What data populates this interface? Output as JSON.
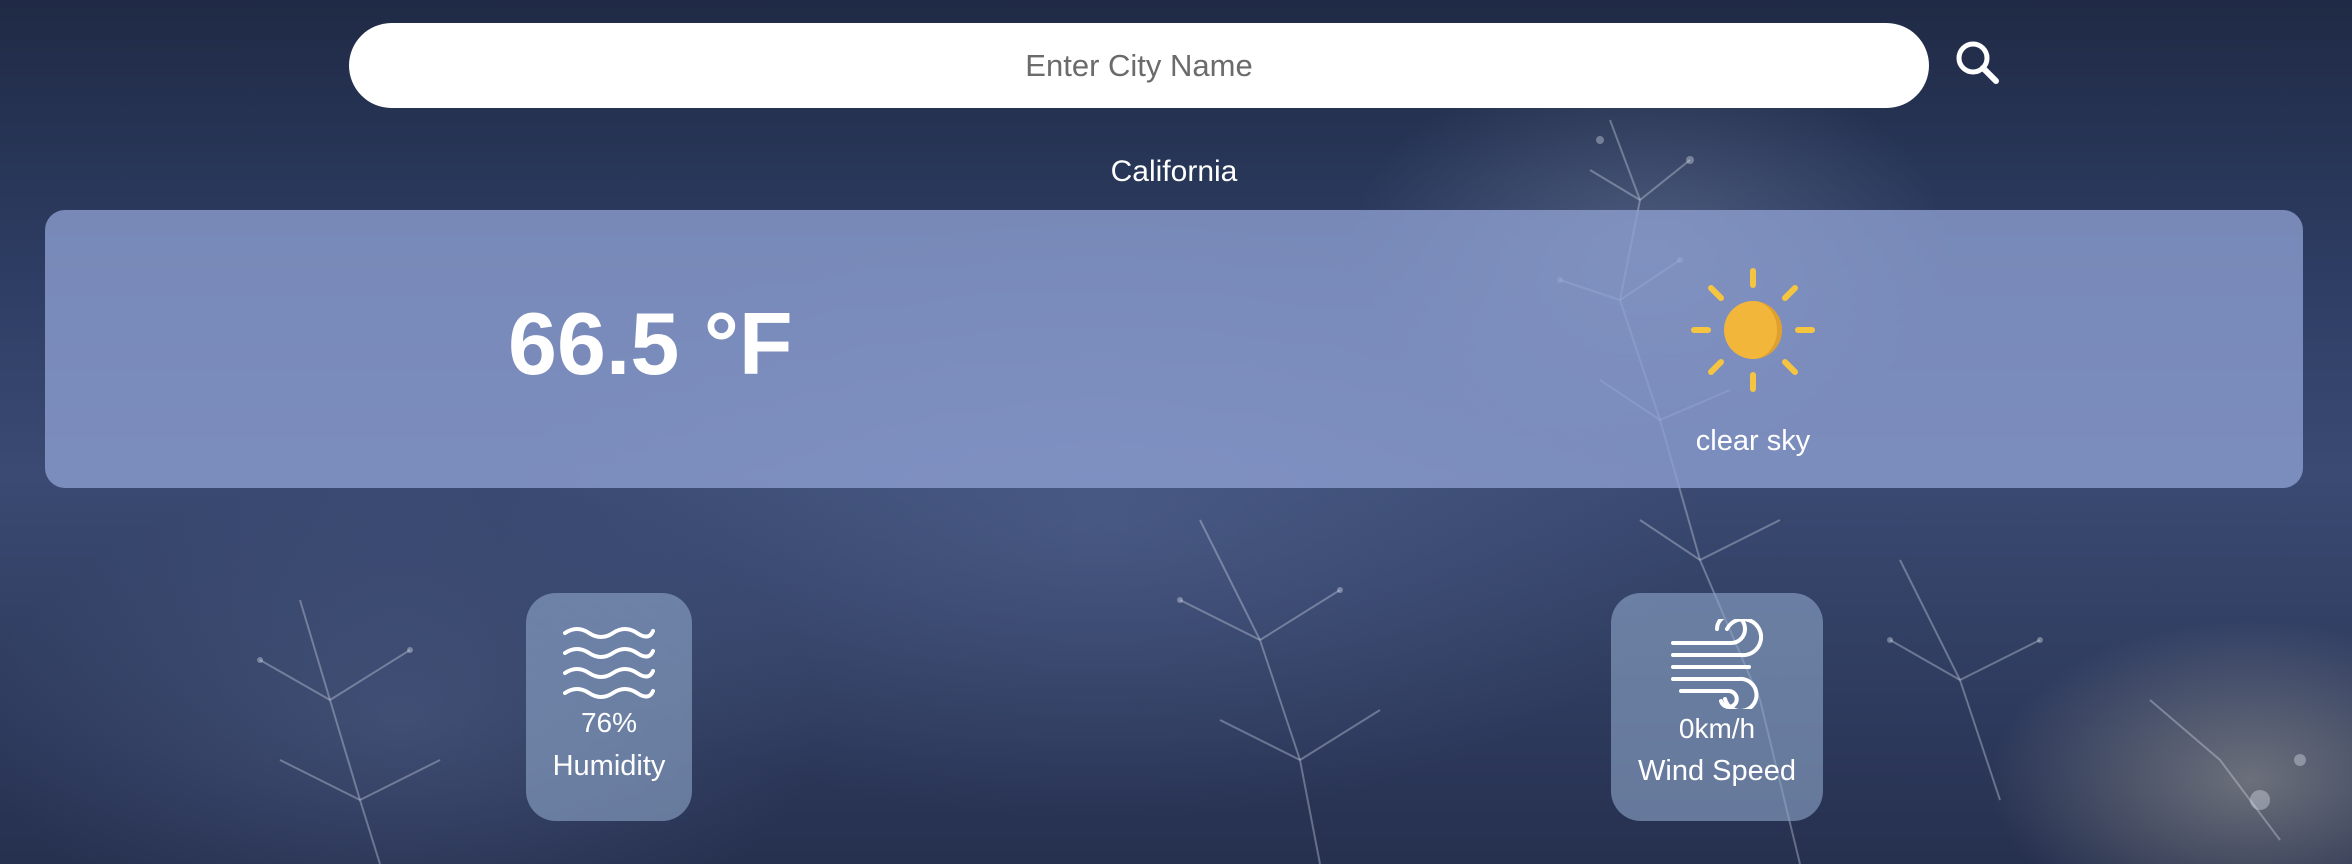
{
  "search": {
    "placeholder": "Enter City Name",
    "button_icon": "search-icon"
  },
  "location": {
    "city": "California"
  },
  "current": {
    "temperature": "66.5 °F",
    "condition_icon": "sun-icon",
    "description": "clear sky"
  },
  "details": {
    "humidity": {
      "icon": "waves-icon",
      "value": "76%",
      "label": "Humidity"
    },
    "wind": {
      "icon": "wind-icon",
      "value": "0km/h",
      "label": "Wind Speed"
    }
  },
  "colors": {
    "sun": "#f2b63a",
    "sun_rays": "#f5c542",
    "card": "#8ea0d2"
  }
}
